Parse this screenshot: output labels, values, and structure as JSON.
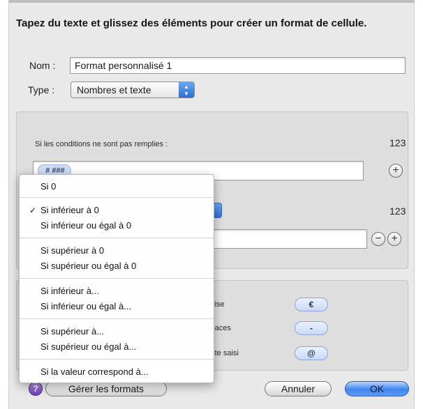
{
  "dialog": {
    "title": "Tapez du texte et glissez des éléments pour créer un format de cellule.",
    "name_label": "Nom :",
    "name_value": "Format personnalisé 1",
    "type_label": "Type :",
    "type_value": "Nombres et texte"
  },
  "rules": {
    "default_condition": "Si les conditions ne sont pas remplies :",
    "default_preview": "123",
    "default_token": "# ###",
    "second_preview": "123"
  },
  "elements": {
    "currency_label": "evise",
    "currency_token": "€",
    "spaces_label": "spaces",
    "spaces_token": "-",
    "text_label": "exte saisi",
    "text_token": "@"
  },
  "menu": {
    "items": [
      {
        "label": "Si 0",
        "checked": false
      },
      {
        "label": "Si inférieur à 0",
        "checked": true
      },
      {
        "label": "Si inférieur ou égal à 0",
        "checked": false
      },
      {
        "label": "Si supérieur à 0",
        "checked": false
      },
      {
        "label": "Si supérieur ou égal à 0",
        "checked": false
      },
      {
        "label": "Si inférieur à...",
        "checked": false
      },
      {
        "label": "Si inférieur ou égal à...",
        "checked": false
      },
      {
        "label": "Si supérieur à...",
        "checked": false
      },
      {
        "label": "Si supérieur ou égal à...",
        "checked": false
      },
      {
        "label": "Si la valeur correspond à...",
        "checked": false
      }
    ],
    "check_glyph": "✓"
  },
  "footer": {
    "help": "?",
    "manage_label": "Gérer les formats",
    "cancel_label": "Annuler",
    "ok_label": "OK"
  }
}
